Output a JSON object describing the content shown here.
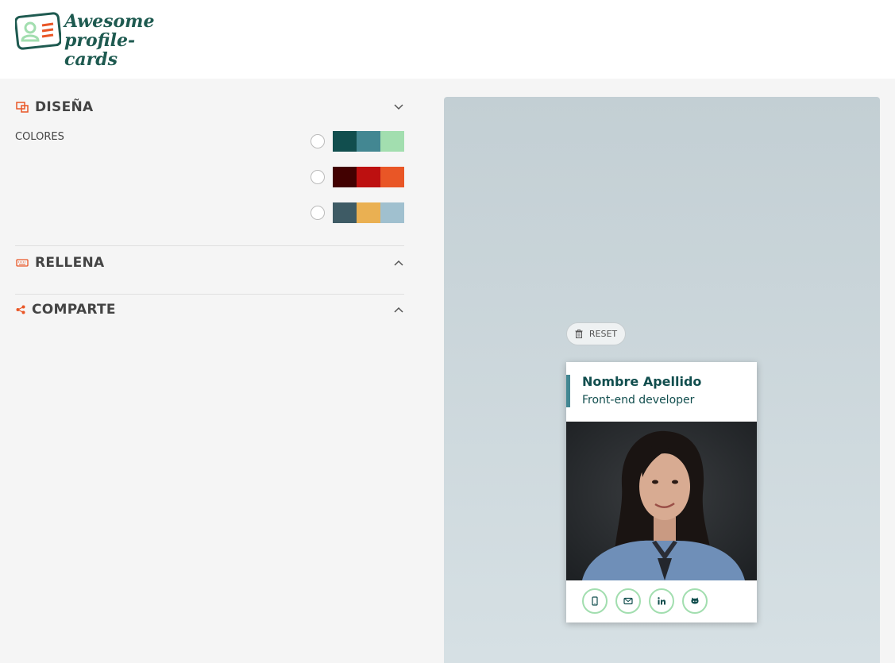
{
  "header": {
    "logo_line1": "Awesome",
    "logo_line2": "profile-cards"
  },
  "sections": {
    "design": {
      "title": "DISEÑA",
      "icon": "design-icon",
      "expanded": true
    },
    "fill": {
      "title": "RELLENA",
      "icon": "keyboard-icon",
      "expanded": false
    },
    "share": {
      "title": "COMPARTE",
      "icon": "share-icon",
      "expanded": false
    }
  },
  "colors": {
    "label": "COLORES",
    "palettes": [
      {
        "colors": [
          "#114e4e",
          "#438792",
          "#a2deaf"
        ],
        "selected": false
      },
      {
        "colors": [
          "#420101",
          "#bd1010",
          "#e95626"
        ],
        "selected": false
      },
      {
        "colors": [
          "#3e5b65",
          "#eab052",
          "#a0c0cf"
        ],
        "selected": false
      }
    ]
  },
  "preview": {
    "reset_label": "RESET",
    "card": {
      "name": "Nombre Apellido",
      "job": "Front-end developer",
      "accent": "#438792",
      "text_color": "#114e4e",
      "social_border": "#a2deaf",
      "social_icons": [
        "phone-icon",
        "email-icon",
        "linkedin-icon",
        "github-icon"
      ]
    }
  },
  "theme": {
    "brand": "#1e5a50",
    "section_icon_color": "#e95626"
  }
}
